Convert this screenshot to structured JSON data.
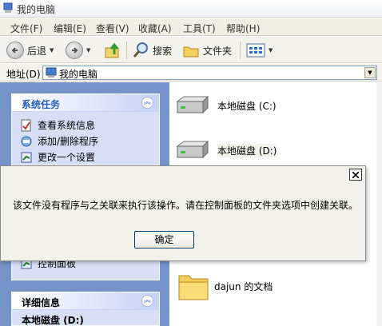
{
  "window": {
    "title": "我的电脑"
  },
  "menu": [
    "文件(F)",
    "编辑(E)",
    "查看(V)",
    "收藏(A)",
    "工具(T)",
    "帮助(H)"
  ],
  "toolbar": {
    "back": "后退",
    "search": "搜索",
    "folders": "文件夹"
  },
  "address": {
    "label": "地址(D)",
    "value": "我的电脑"
  },
  "tasks_panel": {
    "title": "系统任务",
    "items": [
      "查看系统信息",
      "添加/删除程序",
      "更改一个设置"
    ]
  },
  "other_panel": {
    "items": [
      "控制面板"
    ]
  },
  "details_panel": {
    "title": "详细信息",
    "subtitle": "本地磁盘 (D:)"
  },
  "drives": [
    "本地磁盘 (C:)",
    "本地磁盘 (D:)"
  ],
  "folder": {
    "label": "dajun 的文档"
  },
  "dialog": {
    "message": "该文件没有程序与之关联来执行该操作。请在控制面板的文件夹选项中创建关联。",
    "ok": "确定"
  },
  "colors": {
    "task_blue": "#215dc6",
    "pane_bg": "#7593c6"
  }
}
